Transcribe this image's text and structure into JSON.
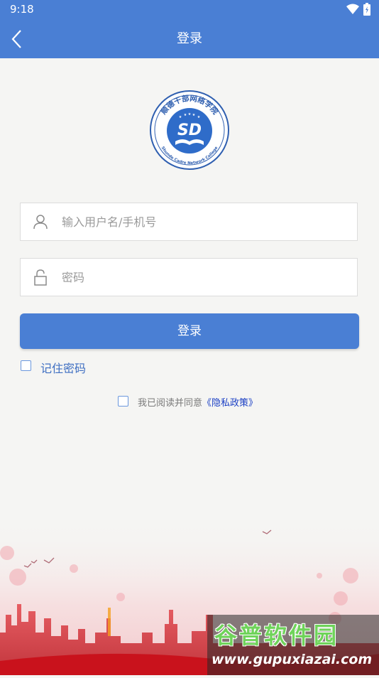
{
  "status_bar": {
    "time": "9:18"
  },
  "header": {
    "title": "登录",
    "back_icon": "chevron-left-icon"
  },
  "logo": {
    "arc_text": "顺德干部网络学院",
    "initials": "SD",
    "english_text": "Shunde Cadre Network College"
  },
  "login_form": {
    "username_placeholder": "输入用户名/手机号",
    "username_icon": "user-icon",
    "password_placeholder": "密码",
    "password_icon": "lock-icon",
    "login_button": "登录",
    "remember_label": "记住密码",
    "agree_text": "我已阅读并同意",
    "privacy_link": "《隐私政策》"
  },
  "watermark": {
    "title": "谷普软件园",
    "url": "www.gupuxiazai.com"
  },
  "colors": {
    "primary": "#4a7fd4",
    "link": "#1a3fc4",
    "background": "#f5f5f3"
  }
}
